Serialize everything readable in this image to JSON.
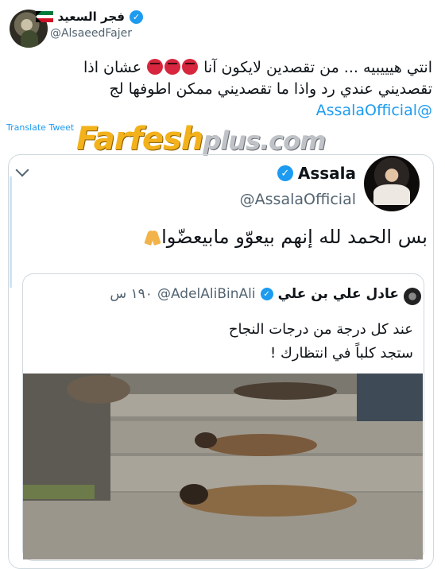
{
  "tweet": {
    "author_name": "فجر السعيد",
    "author_handle": "@AlsaeedFajer",
    "text_line1": "انتي هيييبيه ... من تقصدين لايكون آنا",
    "text_line1_tail": "عشان اذا",
    "text_line2": "تقصديني عندي رد واذا ما تقصديني ممكن اطوفها لج",
    "mention": "@AssalaOfficial",
    "translate_label": "Translate Tweet",
    "angry_emoji_count": 3
  },
  "watermark": {
    "part1": "Farfesh",
    "part2": "plus.com"
  },
  "quoted_tweet": {
    "author_name": "Assala",
    "author_handle": "@AssalaOfficial",
    "text": "بس الحمد لله إنهم بيعوّو مابيعضّوا"
  },
  "nested_quote": {
    "author_name": "عادل علي بن علي",
    "author_handle": "@AdelAliBinAli",
    "time": "١٩٠ س",
    "text_line1": "عند كل درجة من درجات النجاح",
    "text_line2": "ستجد كلباً في انتظارك !"
  },
  "colors": {
    "accent": "#1d9bf0",
    "text": "#0f1419",
    "muted": "#536471",
    "border": "#cfd9de"
  },
  "icons": [
    "verified-badge-icon",
    "kuwait-flag-icon",
    "chevron-down-icon",
    "angry-face-emoji",
    "folded-hands-emoji"
  ]
}
